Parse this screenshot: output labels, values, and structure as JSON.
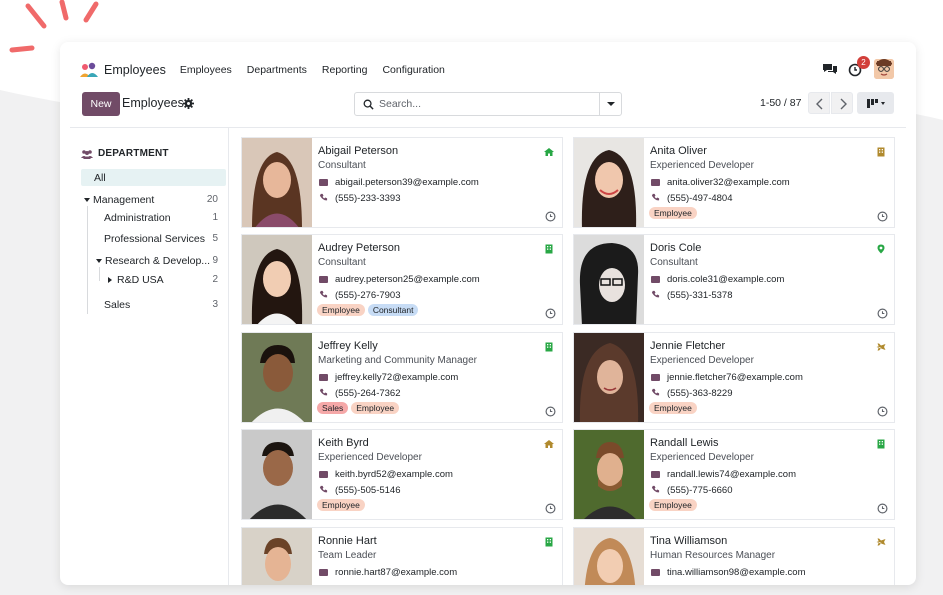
{
  "app": {
    "name": "Employees",
    "menu": [
      "Employees",
      "Departments",
      "Reporting",
      "Configuration"
    ],
    "notification_count": "2"
  },
  "control": {
    "new_label": "New",
    "breadcrumb": "Employees",
    "search_placeholder": "Search...",
    "pager": "1-50 / 87"
  },
  "sidebar": {
    "title": "DEPARTMENT",
    "all_label": "All",
    "items": [
      {
        "label": "Management",
        "count": "20"
      },
      {
        "label": "Administration",
        "count": "1"
      },
      {
        "label": "Professional Services",
        "count": "5"
      },
      {
        "label": "Research & Develop...",
        "count": "9"
      },
      {
        "label": "R&D USA",
        "count": "2"
      },
      {
        "label": "Sales",
        "count": "3"
      }
    ]
  },
  "employees": [
    {
      "name": "Abigail Peterson",
      "job": "Consultant",
      "email": "abigail.peterson39@example.com",
      "phone": "(555)-233-3393",
      "tags": [],
      "status": "home-icon"
    },
    {
      "name": "Anita Oliver",
      "job": "Experienced Developer",
      "email": "anita.oliver32@example.com",
      "phone": "(555)-497-4804",
      "tags": [
        "Employee"
      ],
      "status": "building-icon"
    },
    {
      "name": "Audrey Peterson",
      "job": "Consultant",
      "email": "audrey.peterson25@example.com",
      "phone": "(555)-276-7903",
      "tags": [
        "Employee",
        "Consultant"
      ],
      "status": "building-icon"
    },
    {
      "name": "Doris Cole",
      "job": "Consultant",
      "email": "doris.cole31@example.com",
      "phone": "(555)-331-5378",
      "tags": [],
      "status": "map-pin-icon"
    },
    {
      "name": "Jeffrey Kelly",
      "job": "Marketing and Community Manager",
      "email": "jeffrey.kelly72@example.com",
      "phone": "(555)-264-7362",
      "tags": [
        "Sales",
        "Employee"
      ],
      "status": "building-icon"
    },
    {
      "name": "Jennie Fletcher",
      "job": "Experienced Developer",
      "email": "jennie.fletcher76@example.com",
      "phone": "(555)-363-8229",
      "tags": [
        "Employee"
      ],
      "status": "plane-icon"
    },
    {
      "name": "Keith Byrd",
      "job": "Experienced Developer",
      "email": "keith.byrd52@example.com",
      "phone": "(555)-505-5146",
      "tags": [
        "Employee"
      ],
      "status": "home-icon"
    },
    {
      "name": "Randall Lewis",
      "job": "Experienced Developer",
      "email": "randall.lewis74@example.com",
      "phone": "(555)-775-6660",
      "tags": [
        "Employee"
      ],
      "status": "building-icon"
    },
    {
      "name": "Ronnie Hart",
      "job": "Team Leader",
      "email": "ronnie.hart87@example.com",
      "phone": "",
      "tags": [],
      "status": "building-icon"
    },
    {
      "name": "Tina Williamson",
      "job": "Human Resources Manager",
      "email": "tina.williamson98@example.com",
      "phone": "",
      "tags": [],
      "status": "plane-icon"
    }
  ],
  "colors": {
    "brand": "#714b67",
    "status_green": "#28a745",
    "status_orange": "#b08a2e",
    "tag_employee": "#f9d3c4",
    "tag_consultant": "#c7dcf5",
    "tag_sales": "#f5a8a8"
  }
}
